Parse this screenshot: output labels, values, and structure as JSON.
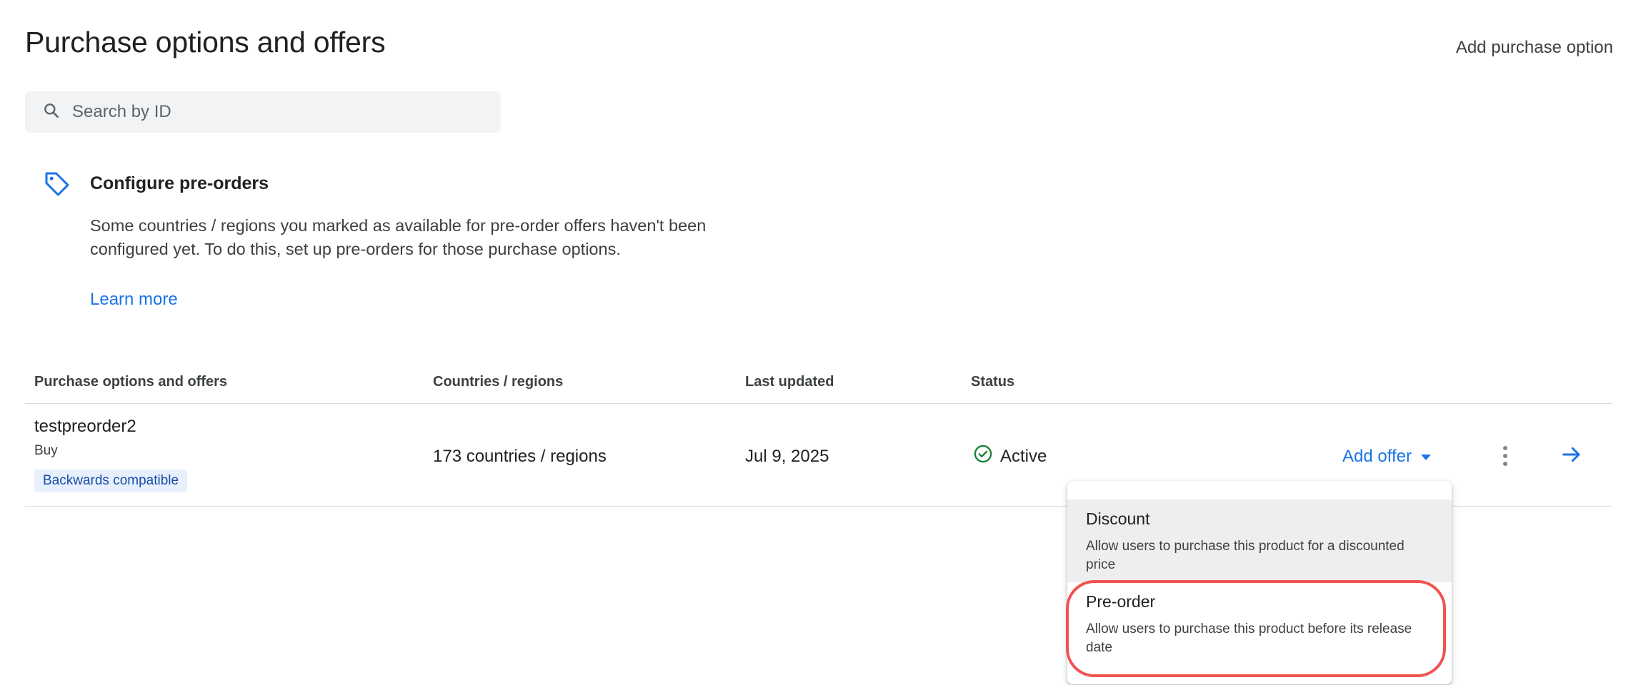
{
  "header": {
    "title": "Purchase options and offers",
    "add_purchase_option": "Add purchase option"
  },
  "search": {
    "placeholder": "Search by ID"
  },
  "callout": {
    "title": "Configure pre-orders",
    "body": "Some countries / regions you marked as available for pre-order offers haven't been configured yet. To do this, set up pre-orders for those purchase options.",
    "link": "Learn more"
  },
  "table": {
    "columns": [
      "Purchase options and offers",
      "Countries / regions",
      "Last updated",
      "Status"
    ],
    "rows": [
      {
        "name": "testpreorder2",
        "type": "Buy",
        "chip": "Backwards compatible",
        "countries": "173 countries / regions",
        "last_updated": "Jul 9, 2025",
        "status": "Active",
        "add_offer": "Add offer"
      }
    ]
  },
  "offer_menu": {
    "items": [
      {
        "title": "Discount",
        "description": "Allow users to purchase this product for a discounted price"
      },
      {
        "title": "Pre-order",
        "description": "Allow users to purchase this product before its release date"
      }
    ]
  },
  "colors": {
    "accent": "#1a73e8",
    "status_active": "#188038",
    "highlight": "#ef5350",
    "chip_bg": "#e8f0fe"
  },
  "icons": {
    "search": "search-icon",
    "tag": "tag-icon",
    "status": "check-circle-icon",
    "caret": "caret-down-icon",
    "more": "more-vert-icon",
    "open": "arrow-forward-icon"
  }
}
